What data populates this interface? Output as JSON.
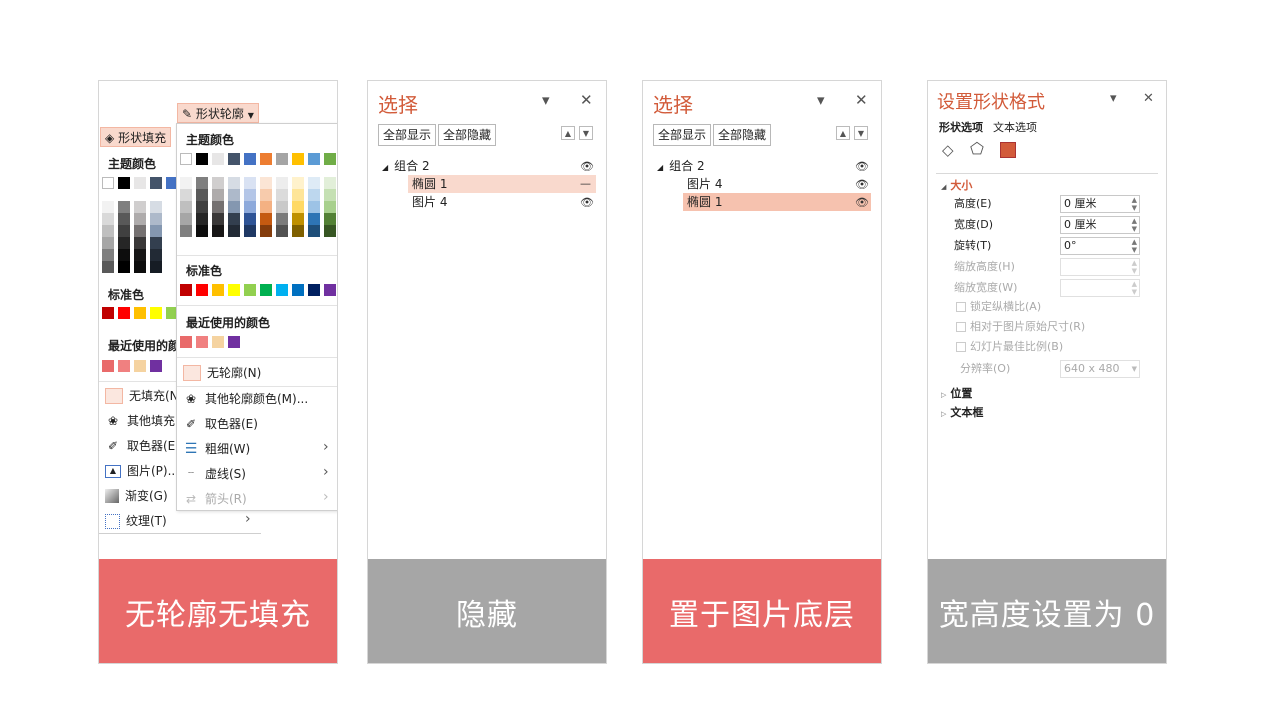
{
  "colors": {
    "accent_red": "#e96a6a",
    "gray": "#a6a6a6",
    "title_orange": "#d25b3a",
    "highlight": "#f9d9cd"
  },
  "card1": {
    "outline_button": "形状轮廓",
    "fill_button": "形状填充",
    "fill_menu": {
      "theme_colors": "主题颜色",
      "standard_colors": "标准色",
      "recent_colors": "最近使用的颜",
      "no_fill": "无填充(N",
      "more_fill": "其他填充",
      "eyedropper": "取色器(E",
      "picture": "图片(P)...",
      "gradient": "渐变(G)",
      "texture": "纹理(T)"
    },
    "outline_menu": {
      "theme_colors": "主题颜色",
      "standard_colors": "标准色",
      "recent_colors": "最近使用的颜色",
      "no_outline": "无轮廓(N)",
      "more_outline": "其他轮廓颜色(M)...",
      "eyedropper": "取色器(E)",
      "weight": "粗细(W)",
      "dashes": "虚线(S)",
      "arrows": "箭头(R)"
    },
    "caption": "无轮廓无填充"
  },
  "card2": {
    "title": "选择",
    "show_all": "全部显示",
    "hide_all": "全部隐藏",
    "items": [
      "组合 2",
      "椭圆 1",
      "图片 4"
    ],
    "caption": "隐藏"
  },
  "card3": {
    "title": "选择",
    "show_all": "全部显示",
    "hide_all": "全部隐藏",
    "items": [
      "组合 2",
      "图片 4",
      "椭圆 1"
    ],
    "caption": "置于图片底层"
  },
  "card4": {
    "title": "设置形状格式",
    "tab_shape": "形状选项",
    "tab_text": "文本选项",
    "section_size": "大小",
    "height_label": "高度(E)",
    "height_value": "0 厘米",
    "width_label": "宽度(D)",
    "width_value": "0 厘米",
    "rotation_label": "旋转(T)",
    "rotation_value": "0°",
    "scale_height_label": "缩放高度(H)",
    "scale_width_label": "缩放宽度(W)",
    "lock_aspect": "锁定纵横比(A)",
    "relative_original": "相对于图片原始尺寸(R)",
    "best_scale": "幻灯片最佳比例(B)",
    "resolution_label": "分辨率(O)",
    "resolution_value": "640 x 480",
    "section_position": "位置",
    "section_textbox": "文本框",
    "caption": "宽高度设置为 0"
  },
  "window_controls": {
    "minimize_glyph": "▾",
    "close_glyph": "✕"
  }
}
